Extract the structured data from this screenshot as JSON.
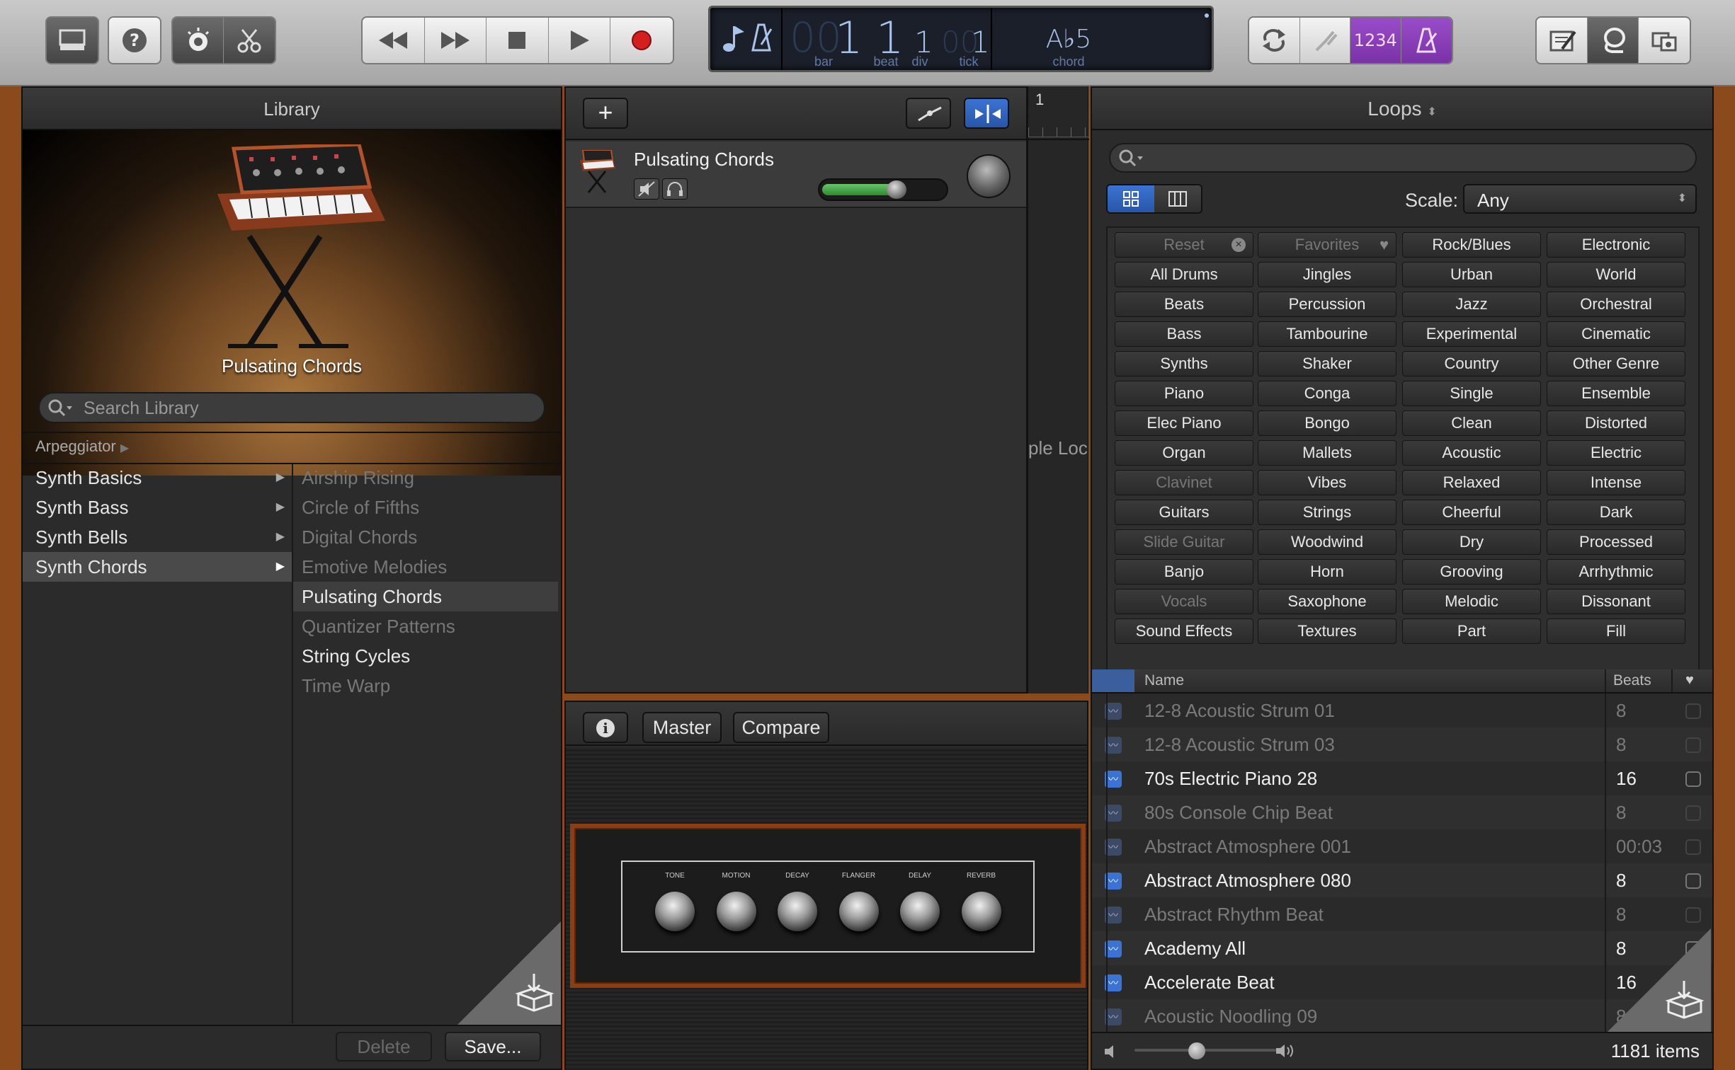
{
  "toolbar": {
    "left_icons": [
      "library-icon",
      "help-icon",
      "smart-controls-icon",
      "editors-icon"
    ],
    "transport": [
      "rewind-icon",
      "fast-forward-icon",
      "stop-icon",
      "play-icon",
      "record-icon"
    ],
    "lcd": {
      "bar_dim": "00",
      "bar": "1",
      "bar_label": "bar",
      "beat": "1",
      "beat_label": "beat",
      "div": "1",
      "div_label": "div",
      "tick_dim": "00",
      "tick": "1",
      "tick_label": "tick",
      "chord": "A♭5",
      "chord_label": "chord"
    },
    "count_in": "1234",
    "right_icons": [
      "note-pad-icon",
      "loop-browser-icon",
      "media-browser-icon"
    ]
  },
  "library": {
    "title": "Library",
    "patch_name": "Pulsating Chords",
    "search_placeholder": "Search Library",
    "breadcrumb": "Arpeggiator",
    "categories": [
      {
        "label": "Synth Basics",
        "selected": false
      },
      {
        "label": "Synth Bass",
        "selected": false
      },
      {
        "label": "Synth Bells",
        "selected": false
      },
      {
        "label": "Synth Chords",
        "selected": true
      }
    ],
    "patches": [
      {
        "label": "Airship Rising",
        "state": "dim"
      },
      {
        "label": "Circle of Fifths",
        "state": "dim"
      },
      {
        "label": "Digital Chords",
        "state": "dim"
      },
      {
        "label": "Emotive Melodies",
        "state": "dim"
      },
      {
        "label": "Pulsating Chords",
        "state": "selected"
      },
      {
        "label": "Quantizer Patterns",
        "state": "dim"
      },
      {
        "label": "String Cycles",
        "state": "normal"
      },
      {
        "label": "Time Warp",
        "state": "dim"
      }
    ],
    "delete_label": "Delete",
    "save_label": "Save..."
  },
  "tracks": {
    "add_label": "+",
    "track_name": "Pulsating Chords",
    "ruler_mark": "1",
    "hint_text": "ple Loc",
    "volume_level": 0.62
  },
  "smart_controls": {
    "master_label": "Master",
    "compare_label": "Compare",
    "knobs": [
      "TONE",
      "MOTION",
      "DECAY",
      "FLANGER",
      "DELAY",
      "REVERB"
    ]
  },
  "loops": {
    "title": "Loops",
    "scale_label": "Scale:",
    "scale_value": "Any",
    "buttons": [
      [
        "Reset",
        "Favorites",
        "Rock/Blues",
        "Electronic"
      ],
      [
        "All Drums",
        "Jingles",
        "Urban",
        "World"
      ],
      [
        "Beats",
        "Percussion",
        "Jazz",
        "Orchestral"
      ],
      [
        "Bass",
        "Tambourine",
        "Experimental",
        "Cinematic"
      ],
      [
        "Synths",
        "Shaker",
        "Country",
        "Other Genre"
      ],
      [
        "Piano",
        "Conga",
        "Single",
        "Ensemble"
      ],
      [
        "Elec Piano",
        "Bongo",
        "Clean",
        "Distorted"
      ],
      [
        "Organ",
        "Mallets",
        "Acoustic",
        "Electric"
      ],
      [
        "Clavinet",
        "Vibes",
        "Relaxed",
        "Intense"
      ],
      [
        "Guitars",
        "Strings",
        "Cheerful",
        "Dark"
      ],
      [
        "Slide Guitar",
        "Woodwind",
        "Dry",
        "Processed"
      ],
      [
        "Banjo",
        "Horn",
        "Grooving",
        "Arrhythmic"
      ],
      [
        "Vocals",
        "Saxophone",
        "Melodic",
        "Dissonant"
      ],
      [
        "Sound Effects",
        "Textures",
        "Part",
        "Fill"
      ]
    ],
    "dim_buttons": [
      "Reset",
      "Favorites",
      "Clavinet",
      "Slide Guitar",
      "Vocals"
    ],
    "col_name": "Name",
    "col_beats": "Beats",
    "results": [
      {
        "name": "12-8 Acoustic Strum 01",
        "beats": "8",
        "active": false
      },
      {
        "name": "12-8 Acoustic Strum 03",
        "beats": "8",
        "active": false
      },
      {
        "name": "70s Electric Piano 28",
        "beats": "16",
        "active": true
      },
      {
        "name": "80s Console Chip Beat",
        "beats": "8",
        "active": false
      },
      {
        "name": "Abstract Atmosphere 001",
        "beats": "00:03",
        "active": false
      },
      {
        "name": "Abstract Atmosphere 080",
        "beats": "8",
        "active": true
      },
      {
        "name": "Abstract Rhythm Beat",
        "beats": "8",
        "active": false
      },
      {
        "name": "Academy All",
        "beats": "8",
        "active": true
      },
      {
        "name": "Accelerate Beat",
        "beats": "16",
        "active": true
      },
      {
        "name": "Acoustic Noodling 09",
        "beats": "8",
        "active": false
      }
    ],
    "item_count": "1181 items"
  },
  "colors": {
    "accent": "#3b73d4",
    "lcd_text": "#a9c3ea",
    "purple": "#8a3cb8",
    "wood": "#8b4a1c",
    "amp_border": "#8a3e14"
  }
}
